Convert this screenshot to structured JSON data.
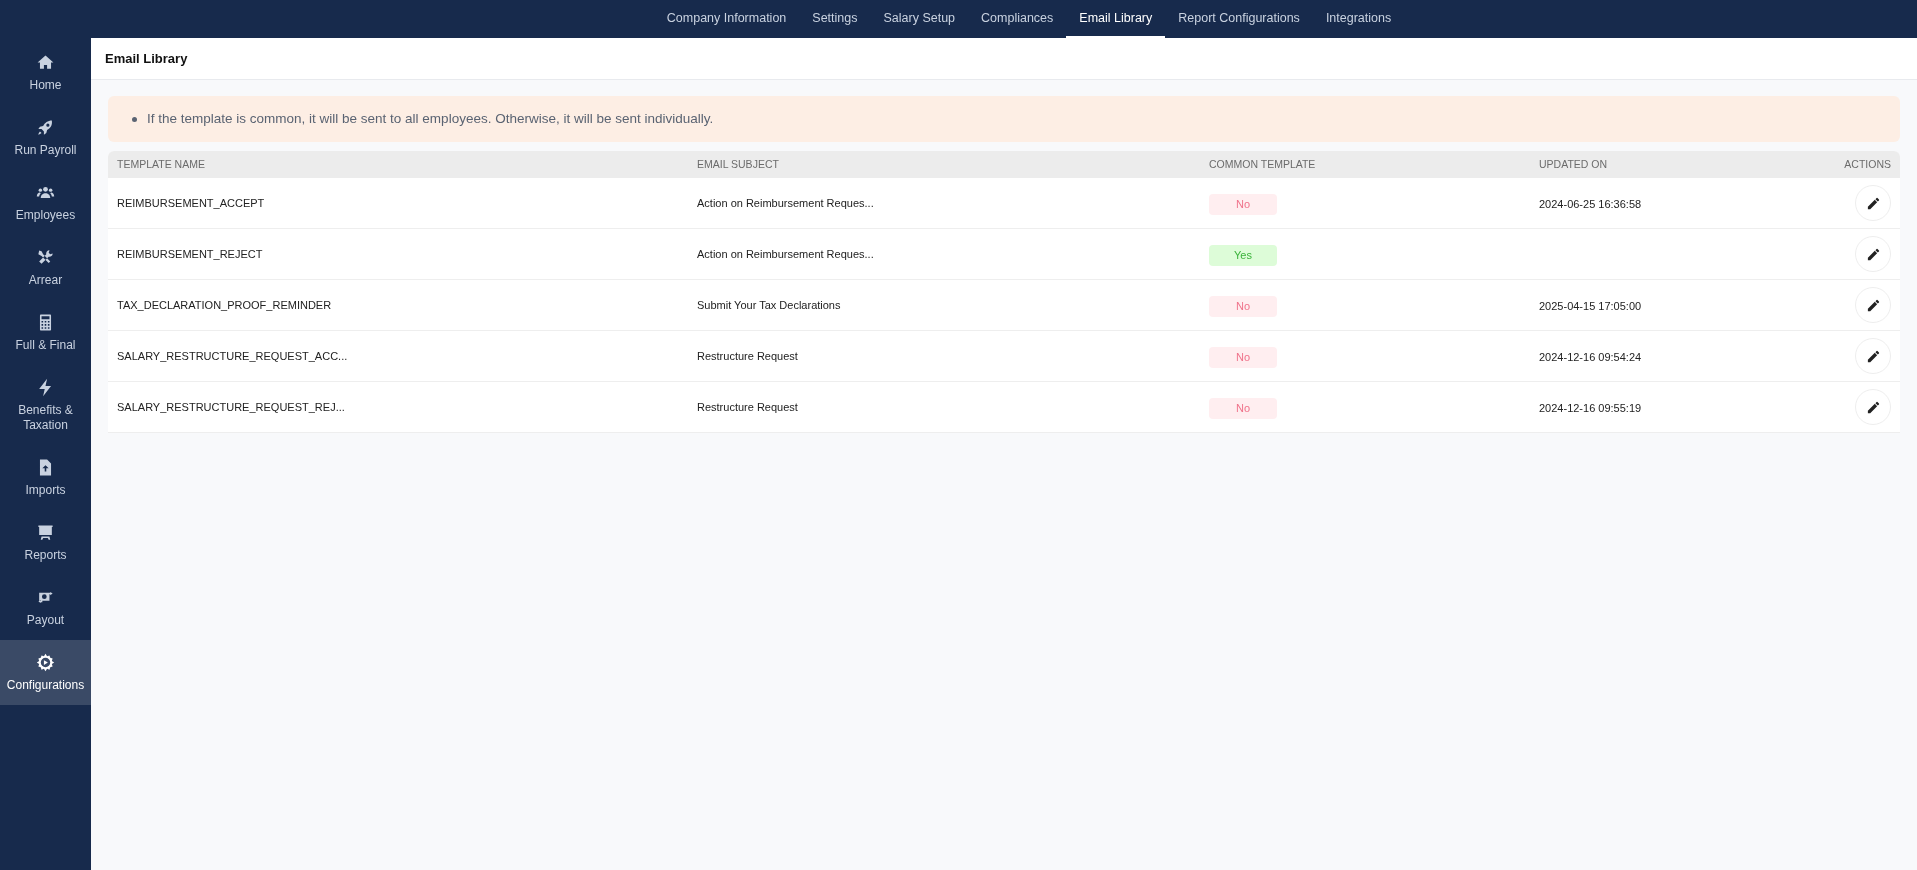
{
  "top_tabs": [
    {
      "label": "Company Information",
      "selected": false
    },
    {
      "label": "Settings",
      "selected": false
    },
    {
      "label": "Salary Setup",
      "selected": false
    },
    {
      "label": "Compliances",
      "selected": false
    },
    {
      "label": "Email Library",
      "selected": true
    },
    {
      "label": "Report Configurations",
      "selected": false
    },
    {
      "label": "Integrations",
      "selected": false
    }
  ],
  "sidebar": {
    "items": [
      {
        "label": "Home",
        "selected": false
      },
      {
        "label": "Run Payroll",
        "selected": false
      },
      {
        "label": "Employees",
        "selected": false
      },
      {
        "label": "Arrear",
        "selected": false
      },
      {
        "label": "Full & Final",
        "selected": false
      },
      {
        "label": "Benefits & Taxation",
        "selected": false
      },
      {
        "label": "Imports",
        "selected": false
      },
      {
        "label": "Reports",
        "selected": false
      },
      {
        "label": "Payout",
        "selected": false
      },
      {
        "label": "Configurations",
        "selected": true
      }
    ]
  },
  "page_title": "Email Library",
  "notice": [
    "If the template is common, it will be sent to all employees. Otherwise, it will be sent individually."
  ],
  "table": {
    "columns": [
      "TEMPLATE NAME",
      "EMAIL SUBJECT",
      "COMMON TEMPLATE",
      "UPDATED ON",
      "ACTIONS"
    ],
    "rows": [
      {
        "template_name": "REIMBURSEMENT_ACCEPT",
        "email_subject": "Action on Reimbursement Reques...",
        "common": false,
        "common_label": "No",
        "updated_on": "2024-06-25 16:36:58"
      },
      {
        "template_name": "REIMBURSEMENT_REJECT",
        "email_subject": "Action on Reimbursement Reques...",
        "common": true,
        "common_label": "Yes"
      },
      {
        "template_name": "TAX_DECLARATION_PROOF_REMINDER",
        "email_subject": "Submit Your Tax Declarations",
        "common": false,
        "common_label": "No",
        "updated_on": "2025-04-15 17:05:00"
      },
      {
        "template_name": "SALARY_RESTRUCTURE_REQUEST_ACC...",
        "email_subject": "Restructure Request",
        "common": false,
        "common_label": "No",
        "updated_on": "2024-12-16 09:54:24"
      },
      {
        "template_name": "SALARY_RESTRUCTURE_REQUEST_REJ...",
        "email_subject": "Restructure Request",
        "common": false,
        "common_label": "No",
        "updated_on": "2024-12-16 09:55:19"
      }
    ]
  }
}
